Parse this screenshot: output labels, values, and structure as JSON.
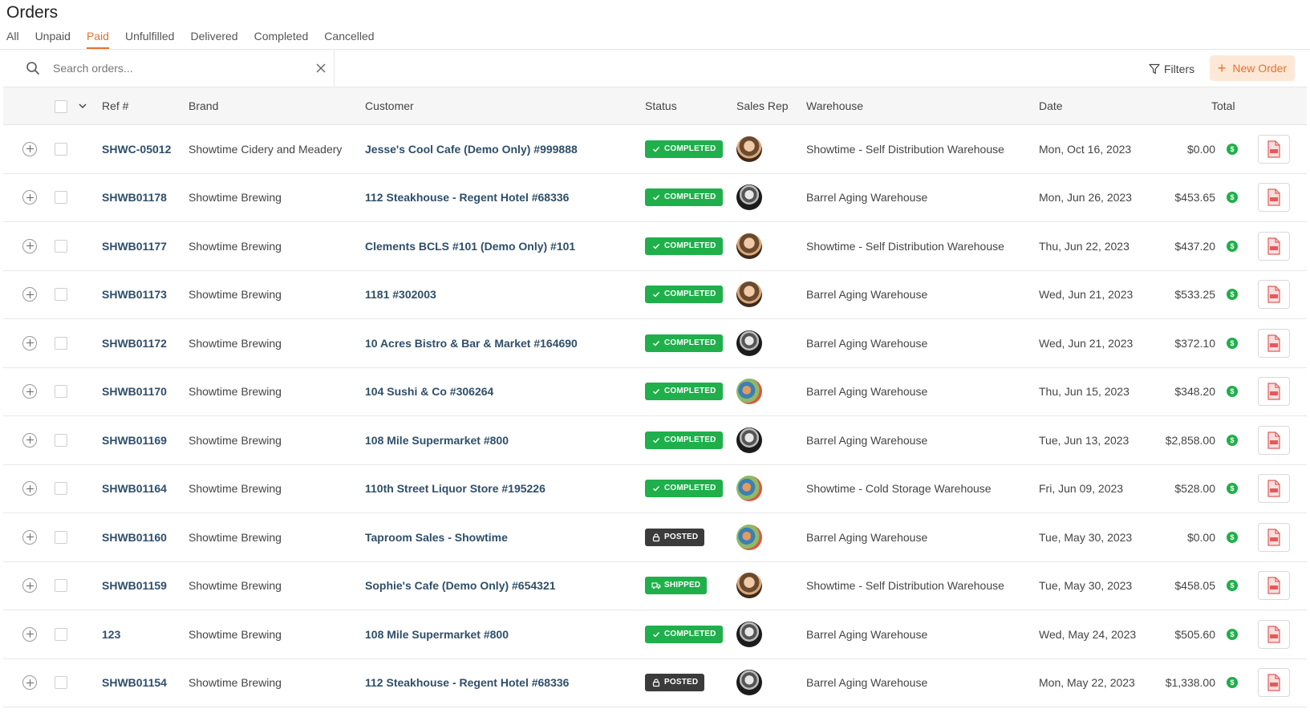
{
  "page": {
    "title": "Orders"
  },
  "tabs": [
    {
      "label": "All"
    },
    {
      "label": "Unpaid"
    },
    {
      "label": "Paid"
    },
    {
      "label": "Unfulfilled"
    },
    {
      "label": "Delivered"
    },
    {
      "label": "Completed"
    },
    {
      "label": "Cancelled"
    }
  ],
  "active_tab": "Paid",
  "search": {
    "placeholder": "Search orders...",
    "value": ""
  },
  "toolbar": {
    "filters_label": "Filters",
    "new_order_label": "New Order"
  },
  "colors": {
    "accent": "#e8712d",
    "accent_bg": "#fde8d7",
    "completed": "#1faf4b",
    "posted": "#3b3b3b",
    "link": "#2f4e6a"
  },
  "table": {
    "headers": {
      "ref": "Ref #",
      "brand": "Brand",
      "customer": "Customer",
      "status": "Status",
      "sales_rep": "Sales Rep",
      "warehouse": "Warehouse",
      "date": "Date",
      "total": "Total"
    },
    "rows": [
      {
        "ref": "SHWC-05012",
        "brand": "Showtime Cidery and Meadery",
        "customer": "Jesse's Cool Cafe (Demo Only) #999888",
        "status": "COMPLETED",
        "status_type": "completed",
        "rep_avatar": "woman",
        "warehouse": "Showtime - Self Distribution Warehouse",
        "date": "Mon, Oct 16, 2023",
        "total": "$0.00"
      },
      {
        "ref": "SHWB01178",
        "brand": "Showtime Brewing",
        "customer": "112 Steakhouse - Regent Hotel #68336",
        "status": "COMPLETED",
        "status_type": "completed",
        "rep_avatar": "mono",
        "warehouse": "Barrel Aging Warehouse",
        "date": "Mon, Jun 26, 2023",
        "total": "$453.65"
      },
      {
        "ref": "SHWB01177",
        "brand": "Showtime Brewing",
        "customer": "Clements BCLS #101 (Demo Only) #101",
        "status": "COMPLETED",
        "status_type": "completed",
        "rep_avatar": "woman",
        "warehouse": "Showtime - Self Distribution Warehouse",
        "date": "Thu, Jun 22, 2023",
        "total": "$437.20"
      },
      {
        "ref": "SHWB01173",
        "brand": "Showtime Brewing",
        "customer": "1181 #302003",
        "status": "COMPLETED",
        "status_type": "completed",
        "rep_avatar": "woman",
        "warehouse": "Barrel Aging Warehouse",
        "date": "Wed, Jun 21, 2023",
        "total": "$533.25"
      },
      {
        "ref": "SHWB01172",
        "brand": "Showtime Brewing",
        "customer": "10 Acres Bistro & Bar & Market #164690",
        "status": "COMPLETED",
        "status_type": "completed",
        "rep_avatar": "mono",
        "warehouse": "Barrel Aging Warehouse",
        "date": "Wed, Jun 21, 2023",
        "total": "$372.10"
      },
      {
        "ref": "SHWB01170",
        "brand": "Showtime Brewing",
        "customer": "104 Sushi & Co #306264",
        "status": "COMPLETED",
        "status_type": "completed",
        "rep_avatar": "kids",
        "warehouse": "Barrel Aging Warehouse",
        "date": "Thu, Jun 15, 2023",
        "total": "$348.20"
      },
      {
        "ref": "SHWB01169",
        "brand": "Showtime Brewing",
        "customer": "108 Mile Supermarket #800",
        "status": "COMPLETED",
        "status_type": "completed",
        "rep_avatar": "mono",
        "warehouse": "Barrel Aging Warehouse",
        "date": "Tue, Jun 13, 2023",
        "total": "$2,858.00"
      },
      {
        "ref": "SHWB01164",
        "brand": "Showtime Brewing",
        "customer": "110th Street Liquor Store #195226",
        "status": "COMPLETED",
        "status_type": "completed",
        "rep_avatar": "kids",
        "warehouse": "Showtime - Cold Storage Warehouse",
        "date": "Fri, Jun 09, 2023",
        "total": "$528.00"
      },
      {
        "ref": "SHWB01160",
        "brand": "Showtime Brewing",
        "customer": "Taproom Sales - Showtime",
        "status": "POSTED",
        "status_type": "posted",
        "rep_avatar": "kids",
        "warehouse": "Barrel Aging Warehouse",
        "date": "Tue, May 30, 2023",
        "total": "$0.00"
      },
      {
        "ref": "SHWB01159",
        "brand": "Showtime Brewing",
        "customer": "Sophie's Cafe (Demo Only) #654321",
        "status": "SHIPPED",
        "status_type": "shipped",
        "rep_avatar": "woman",
        "warehouse": "Showtime - Self Distribution Warehouse",
        "date": "Tue, May 30, 2023",
        "total": "$458.05"
      },
      {
        "ref": "123",
        "brand": "Showtime Brewing",
        "customer": "108 Mile Supermarket #800",
        "status": "COMPLETED",
        "status_type": "completed",
        "rep_avatar": "mono",
        "warehouse": "Barrel Aging Warehouse",
        "date": "Wed, May 24, 2023",
        "total": "$505.60"
      },
      {
        "ref": "SHWB01154",
        "brand": "Showtime Brewing",
        "customer": "112 Steakhouse - Regent Hotel #68336",
        "status": "POSTED",
        "status_type": "posted",
        "rep_avatar": "mono",
        "warehouse": "Barrel Aging Warehouse",
        "date": "Mon, May 22, 2023",
        "total": "$1,338.00"
      }
    ]
  }
}
